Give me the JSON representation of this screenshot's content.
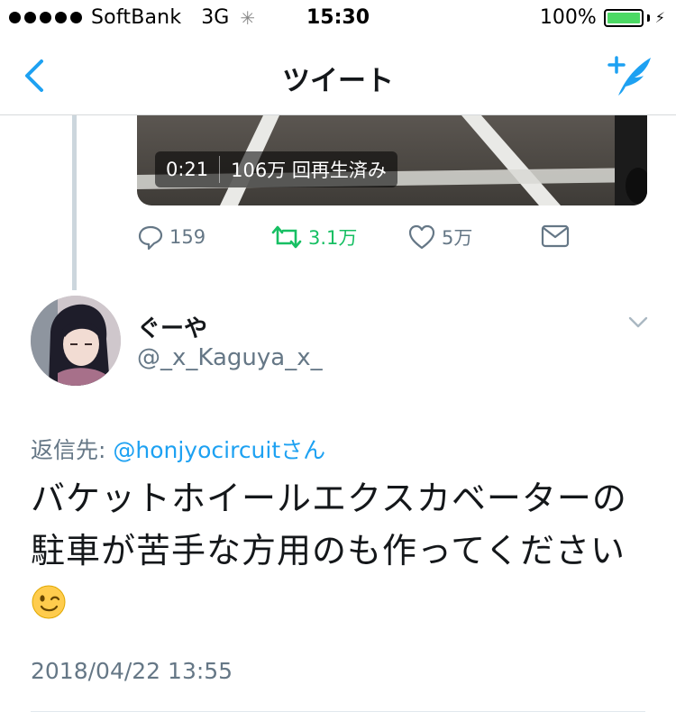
{
  "status_bar": {
    "carrier": "SoftBank",
    "network": "3G",
    "time": "15:30",
    "battery_percent": "100%",
    "battery_level": 1.0
  },
  "nav": {
    "title": "ツイート",
    "back_icon": "chevron-left-icon",
    "compose_icon": "compose-tweet-icon",
    "accent": "#1da1f2"
  },
  "previous_tweet": {
    "media": {
      "duration": "0:21",
      "views": "106万 回再生済み"
    },
    "actions": {
      "reply_count": "159",
      "retweet_count": "3.1万",
      "like_count": "5万"
    }
  },
  "tweet": {
    "display_name": "ぐーや",
    "handle": "@_x_Kaguya_x_",
    "reply_prefix": "返信先: ",
    "reply_mention": "@honjyocircuit",
    "reply_suffix": "さん",
    "text": "バケットホイールエクスカベーターの駐車が苦手な方用のも作ってください",
    "emoji": "winking-face-emoji",
    "timestamp": "2018/04/22 13:55"
  },
  "colors": {
    "text": "#14171a",
    "secondary": "#657786",
    "link": "#1da1f2",
    "retweet": "#17bf63",
    "battery": "#4cd964"
  }
}
